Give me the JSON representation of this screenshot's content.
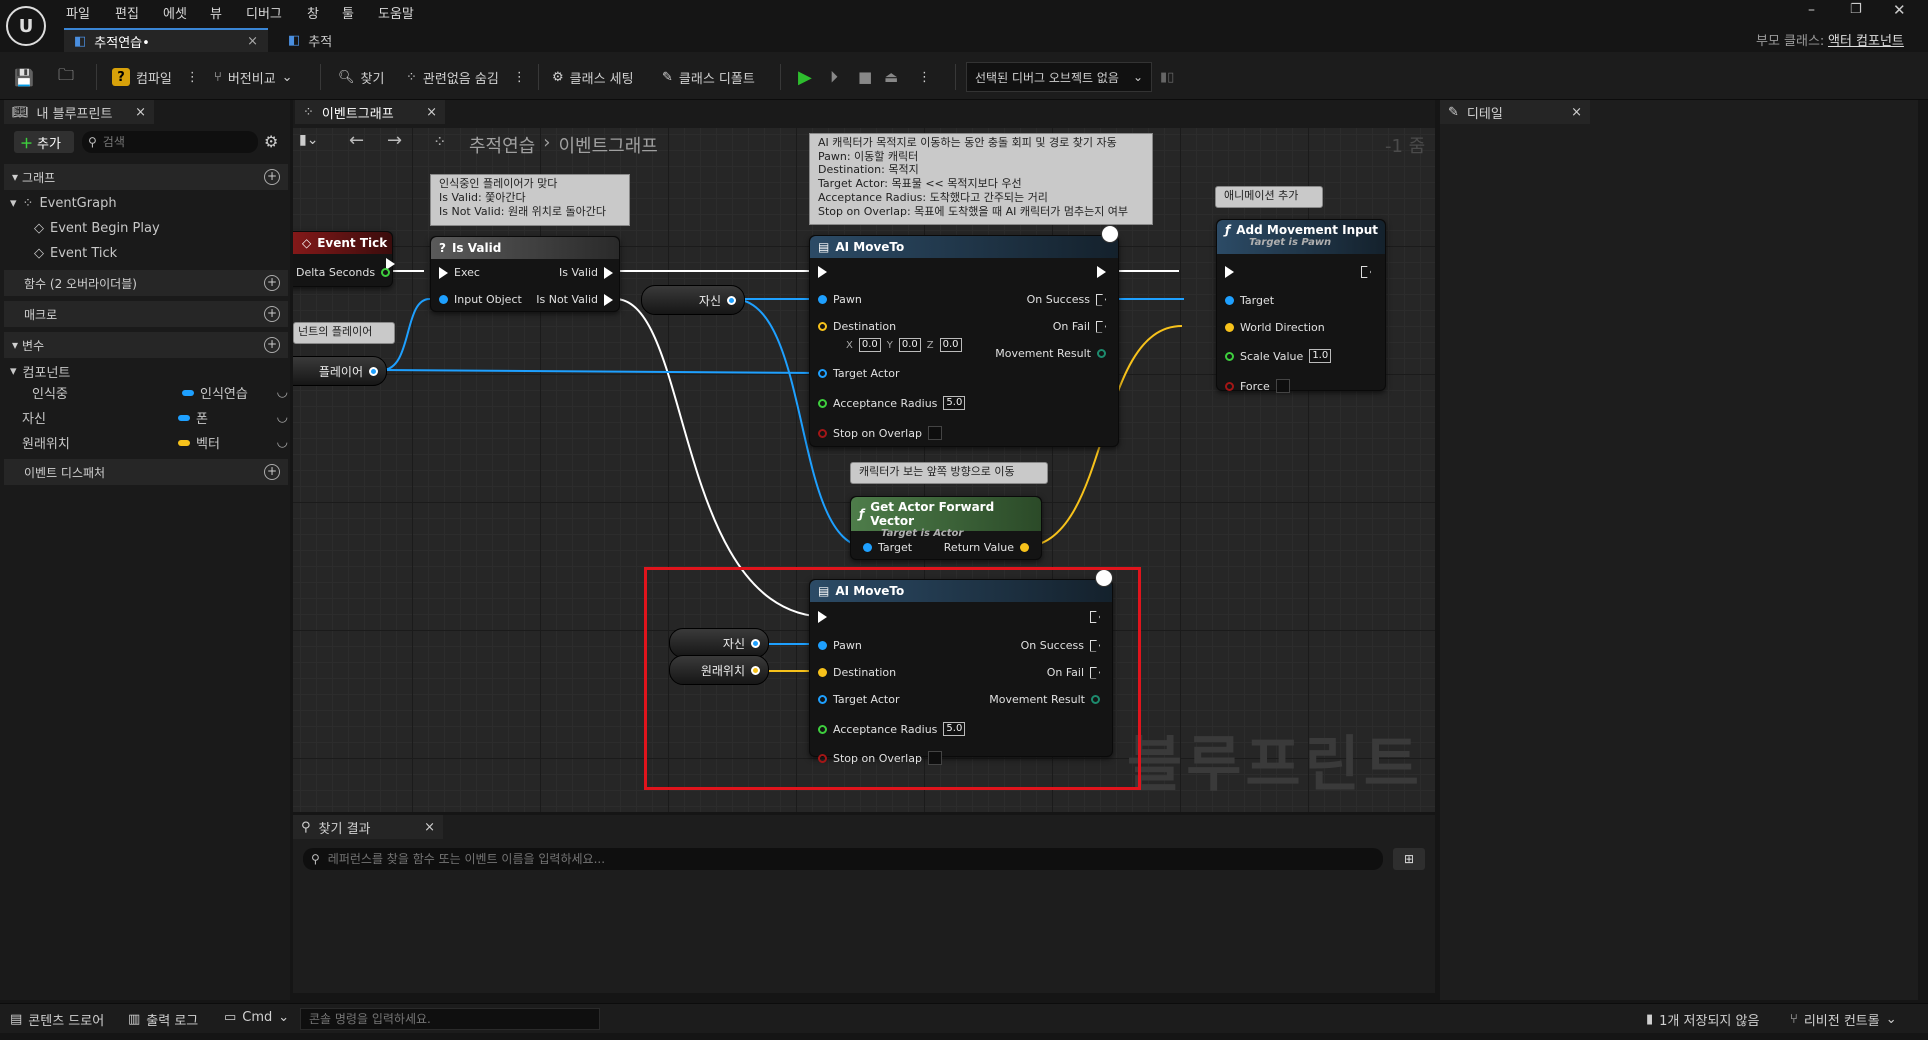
{
  "menu": [
    "파일",
    "편집",
    "에셋",
    "뷰",
    "디버그",
    "창",
    "툴",
    "도움말"
  ],
  "doc_tabs": {
    "active": "추적연습•",
    "other": "추적"
  },
  "parent_class": {
    "label": "부모 클래스:",
    "value": "액터 컴포넌트"
  },
  "window_controls": {
    "minimize": "–",
    "restore": "❐",
    "close": "✕"
  },
  "toolbar": {
    "compile": "컴파일",
    "diff": "버전비교",
    "find": "찾기",
    "hide_unrelated": "관련없음 숨김",
    "class_settings": "클래스 세팅",
    "class_defaults": "클래스 디폴트",
    "debug_object": "선택된 디버그 오브젝트 없음"
  },
  "my_blueprint": {
    "tab": "내 블루프린트",
    "add": "추가",
    "search_placeholder": "검색",
    "graph_section": "그래프",
    "event_graph": "EventGraph",
    "events": [
      "Event Begin Play",
      "Event Tick"
    ],
    "functions_section": "함수 (2 오버라이더블)",
    "macros_section": "매크로",
    "variables_section": "변수",
    "components": "컴포넌트",
    "vars": [
      {
        "name": "인식중",
        "type": "인식연습",
        "color": "#1ea0ff"
      },
      {
        "name": "자신",
        "type": "폰",
        "color": "#1ea0ff"
      },
      {
        "name": "원래위치",
        "type": "벡터",
        "color": "#f7c21b"
      }
    ],
    "dispatchers_section": "이벤트 디스패처"
  },
  "graph": {
    "tab": "이벤트그래프",
    "breadcrumb_root": "추적연습",
    "breadcrumb_leaf": "이벤트그래프",
    "zoom": "-1 줌",
    "watermark": "블루프린트",
    "comments": {
      "isvalid": "인식중인 플레이어가 맞다\nIs Valid: 쫓아간다\nIs Not Valid: 원래 위치로 돌아간다",
      "moveto": "AI 캐릭터가 목적지로 이동하는 동안 충돌 회피 및 경로 찾기 자동\nPawn: 이동할 캐릭터\nDestination: 목적지\nTarget Actor: 목표물 << 목적지보다 우선\nAcceptance Radius: 도착했다고 간주되는 거리\nStop on Overlap: 목표에 도착했을 때 AI 캐릭터가 멈추는지 여부",
      "anim": "애니메이션 추가",
      "forward": "캐릭터가 보는 앞쪽 방향으로 이동",
      "player": "넌트의 플레이어"
    },
    "event_tick": {
      "title": "Event Tick",
      "delta": "Delta Seconds"
    },
    "is_valid": {
      "title": "Is Valid",
      "exec": "Exec",
      "input": "Input Object",
      "valid": "Is Valid",
      "not_valid": "Is Not Valid"
    },
    "var_player": "플레이어",
    "var_self": "자신",
    "var_origin": "원래위치",
    "move_to": {
      "title": "AI MoveTo",
      "pawn": "Pawn",
      "destination": "Destination",
      "target_actor": "Target Actor",
      "radius": "Acceptance Radius",
      "stop": "Stop on Overlap",
      "success": "On Success",
      "fail": "On Fail",
      "result": "Movement Result",
      "x": "X",
      "y": "Y",
      "z": "Z",
      "dx": "0.0",
      "dy": "0.0",
      "dz": "0.0",
      "radius_val": "5.0"
    },
    "add_move": {
      "title": "Add Movement Input",
      "subtitle": "Target is Pawn",
      "target": "Target",
      "dir": "World Direction",
      "scale": "Scale Value",
      "scale_val": "1.0",
      "force": "Force"
    },
    "forward": {
      "title": "Get Actor Forward Vector",
      "subtitle": "Target is Actor",
      "target": "Target",
      "ret": "Return Value"
    }
  },
  "details": {
    "tab": "디테일"
  },
  "find": {
    "tab": "찾기 결과",
    "placeholder": "레퍼런스를 찾을 함수 또는 이벤트 이름을 입력하세요..."
  },
  "status": {
    "content_drawer": "콘텐츠 드로어",
    "output_log": "출력 로그",
    "cmd": "Cmd",
    "console_placeholder": "콘솔 명령을 입력하세요.",
    "unsaved": "1개 저장되지 않음",
    "revision": "리비전 컨트롤"
  }
}
